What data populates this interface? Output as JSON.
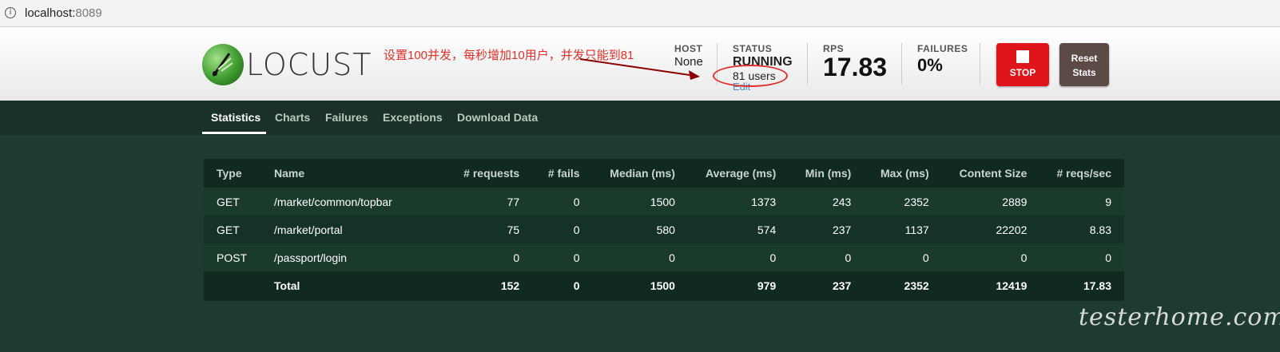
{
  "browser": {
    "url_host": "localhost:",
    "url_port": "8089"
  },
  "header": {
    "logo_text": "LOCUST",
    "annotation": "设置100并发，每秒增加10用户，并发只能到81",
    "host": {
      "label": "HOST",
      "value": "None"
    },
    "status": {
      "label": "STATUS",
      "value": "RUNNING",
      "users": "81 users",
      "edit": "Edit"
    },
    "rps": {
      "label": "RPS",
      "value": "17.83"
    },
    "failures": {
      "label": "FAILURES",
      "value": "0%"
    },
    "stop_label": "STOP",
    "reset_label_1": "Reset",
    "reset_label_2": "Stats"
  },
  "tabs": [
    {
      "label": "Statistics",
      "active": true
    },
    {
      "label": "Charts"
    },
    {
      "label": "Failures"
    },
    {
      "label": "Exceptions"
    },
    {
      "label": "Download Data"
    }
  ],
  "table": {
    "headers": [
      "Type",
      "Name",
      "# requests",
      "# fails",
      "Median (ms)",
      "Average (ms)",
      "Min (ms)",
      "Max (ms)",
      "Content Size",
      "# reqs/sec"
    ],
    "rows": [
      [
        "GET",
        "/market/common/topbar",
        "77",
        "0",
        "1500",
        "1373",
        "243",
        "2352",
        "2889",
        "9"
      ],
      [
        "GET",
        "/market/portal",
        "75",
        "0",
        "580",
        "574",
        "237",
        "1137",
        "22202",
        "8.83"
      ],
      [
        "POST",
        "/passport/login",
        "0",
        "0",
        "0",
        "0",
        "0",
        "0",
        "0",
        "0"
      ]
    ],
    "total": [
      "",
      "Total",
      "152",
      "0",
      "1500",
      "979",
      "237",
      "2352",
      "12419",
      "17.83"
    ]
  },
  "watermark": "testerhome.com",
  "colors": {
    "stop": "#e0151b",
    "reset": "#5b4a45",
    "annotation": "#e0302a"
  }
}
